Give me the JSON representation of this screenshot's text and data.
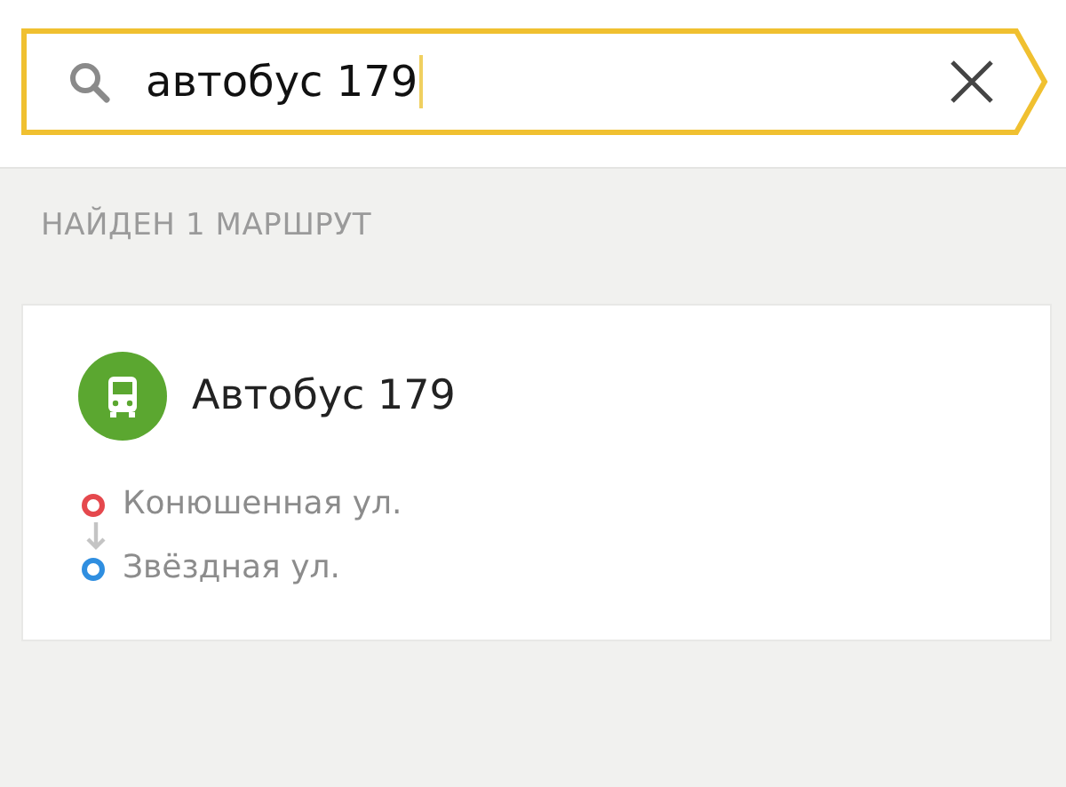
{
  "search": {
    "value": "автобус 179"
  },
  "results_header": "НАЙДЕН 1 МАРШРУТ",
  "routes": [
    {
      "kind": "bus",
      "title": "Автобус 179",
      "stops": [
        {
          "name": "Конюшенная ул.",
          "color": "#e5484d"
        },
        {
          "name": "Звёздная ул.",
          "color": "#2f8ee0"
        }
      ]
    }
  ]
}
